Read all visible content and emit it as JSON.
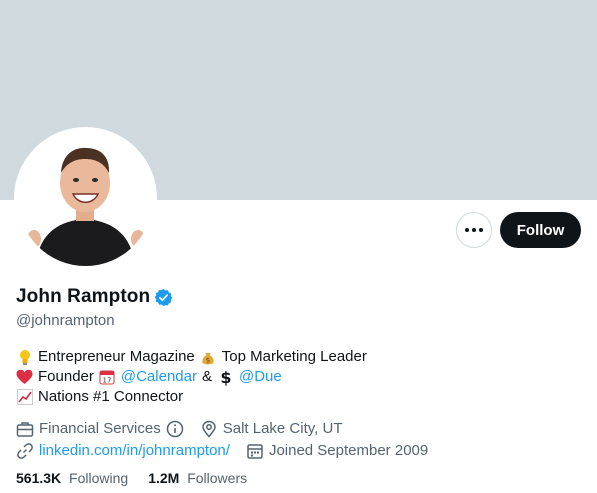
{
  "banner": {
    "color": "#cfd9de"
  },
  "actions": {
    "more_icon": "more-horizontal-icon",
    "follow_label": "Follow"
  },
  "profile": {
    "name": "John Rampton",
    "handle": "@johnrampton",
    "verified_color": "#1d9bf0"
  },
  "bio": {
    "line1": {
      "part1": "Entrepreneur Magazine",
      "part2": "Top Marketing Leader"
    },
    "line2": {
      "part1": "Founder",
      "mention1": "@Calendar",
      "ampersand": "&",
      "mention2": "@Due"
    },
    "line3": {
      "part1": "Nations #1 Connector"
    }
  },
  "meta": {
    "category": "Financial Services",
    "location": "Salt Lake City, UT",
    "website": "linkedin.com/in/johnrampton/",
    "joined": "Joined September 2009"
  },
  "counts": {
    "following_num": "561.3K",
    "following_label": "Following",
    "followers_num": "1.2M",
    "followers_label": "Followers"
  }
}
